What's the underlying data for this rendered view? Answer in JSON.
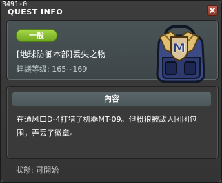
{
  "window": {
    "quest_id": "3491-0",
    "title": "QUEST INFO"
  },
  "quest": {
    "category_badge": "一般",
    "name": "[地球防御本部]丢失之物",
    "required_level": "建議等级: 165~169",
    "icon": "m-emblem-bag-icon"
  },
  "content": {
    "header": "內容",
    "text": "在通风口D-4打猎了机器MT-09。但粉狼被敌人团团包围，弄丢了徽章。"
  },
  "status": {
    "text": "狀態:  可開始"
  }
}
